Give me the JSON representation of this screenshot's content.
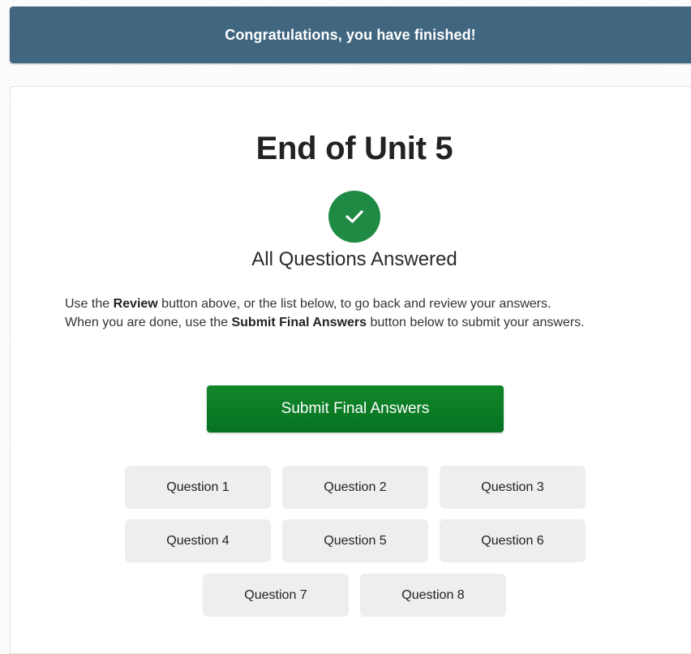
{
  "banner": {
    "text": "Congratulations, you have finished!"
  },
  "main": {
    "title": "End of Unit 5",
    "status_icon": "checkmark-icon",
    "status_text": "All Questions Answered",
    "instructions": {
      "line1_before": "Use the ",
      "review_word": "Review",
      "line1_after": " button above, or the list below, to go back and review your answers.",
      "line2_before": "When you are done, use the ",
      "submit_phrase": "Submit Final Answers",
      "line2_after": " button below to submit your answers."
    },
    "submit_label": "Submit Final Answers",
    "questions": [
      "Question 1",
      "Question 2",
      "Question 3",
      "Question 4",
      "Question 5",
      "Question 6",
      "Question 7",
      "Question 8"
    ]
  },
  "colors": {
    "banner": "#416680",
    "check": "#1e8a44",
    "submit": "#0b7c26",
    "question_bg": "#eeeeee"
  }
}
